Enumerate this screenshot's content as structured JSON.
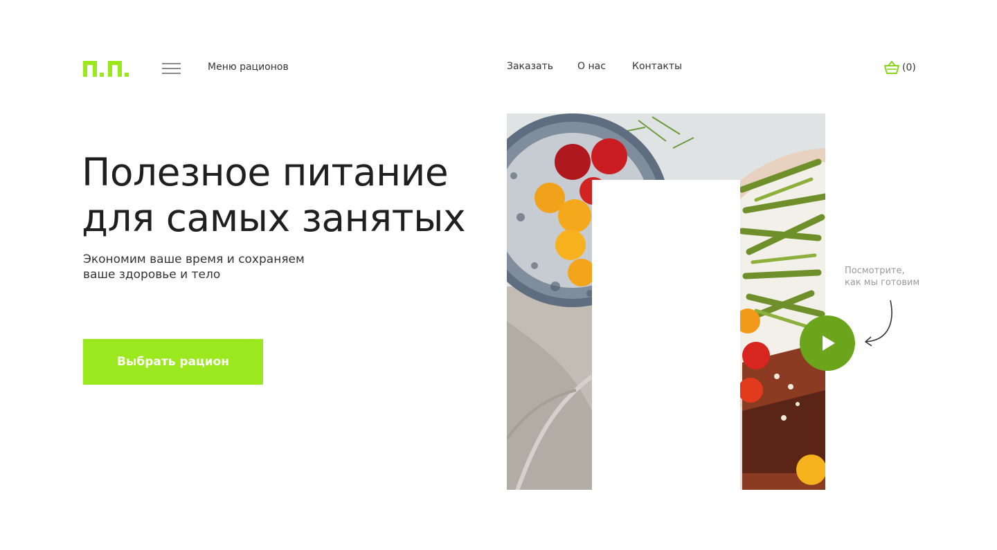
{
  "header": {
    "logo_text": "п.п.",
    "menu_label": "Меню рационов",
    "nav": [
      {
        "label": "Заказать"
      },
      {
        "label": "О нас"
      },
      {
        "label": "Контакты"
      }
    ],
    "cart_count": "(0)"
  },
  "hero": {
    "title_line1": "Полезное питание",
    "title_line2": "для самых занятых",
    "subtitle_line1": "Экономим ваше время и сохраняем",
    "subtitle_line2": "ваше здоровье и тело",
    "cta_label": "Выбрать рацион"
  },
  "video": {
    "caption_line1": "Посмотрите,",
    "caption_line2": "как мы готовим"
  },
  "colors": {
    "accent": "#9be81e",
    "play": "#6aa51c",
    "text": "#1f1f1f"
  },
  "icons": [
    "menu-icon",
    "basket-icon",
    "play-icon",
    "curved-arrow-icon"
  ]
}
